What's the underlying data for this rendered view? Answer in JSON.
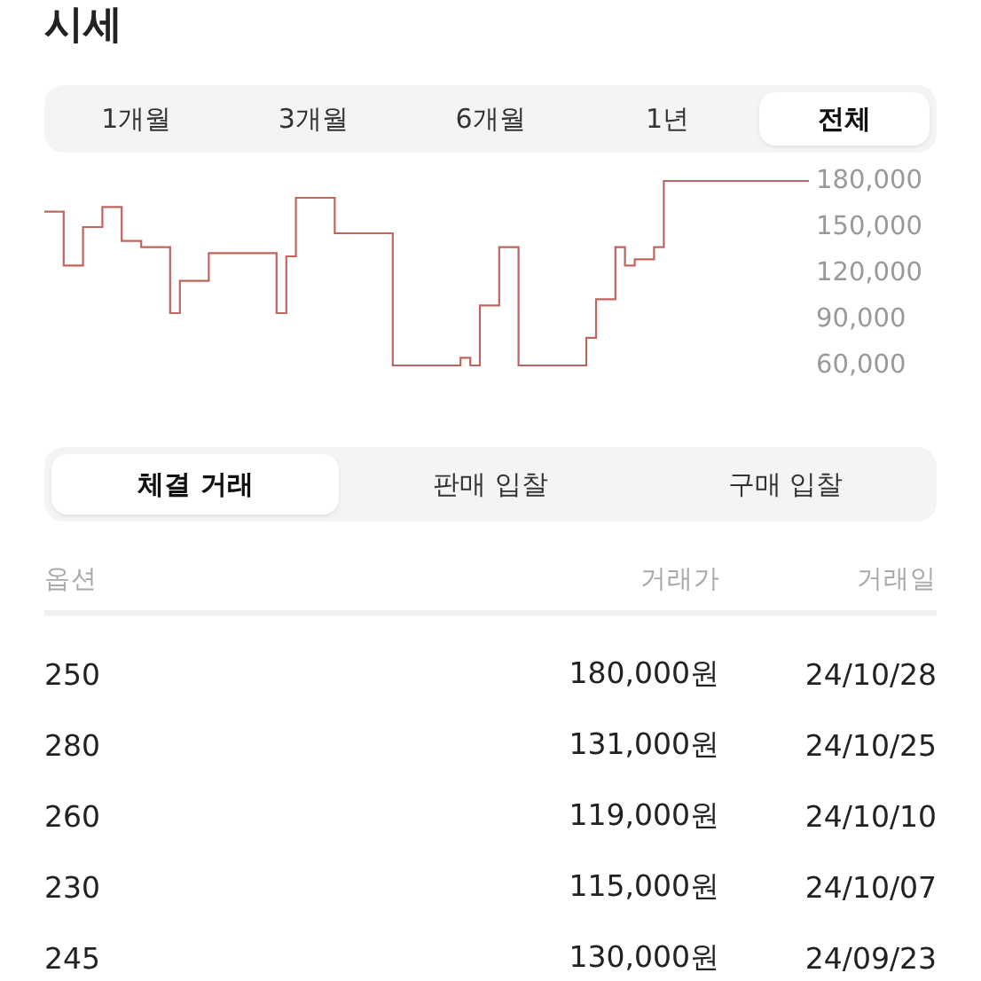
{
  "title": "시세",
  "period_tabs": [
    {
      "label": "1개월",
      "selected": false
    },
    {
      "label": "3개월",
      "selected": false
    },
    {
      "label": "6개월",
      "selected": false
    },
    {
      "label": "1년",
      "selected": false
    },
    {
      "label": "전체",
      "selected": true
    }
  ],
  "price_chart": {
    "chart_data": {
      "type": "line",
      "ylim": [
        60000,
        180000
      ],
      "yticks": [
        {
          "value": 180000,
          "label": "180,000"
        },
        {
          "value": 150000,
          "label": "150,000"
        },
        {
          "value": 120000,
          "label": "120,000"
        },
        {
          "value": 90000,
          "label": "90,000"
        },
        {
          "value": 60000,
          "label": "60,000"
        }
      ],
      "series": [
        {
          "color": "#c0655c",
          "values": [
            160000,
            160000,
            125000,
            125000,
            150000,
            150000,
            163000,
            163000,
            141000,
            141000,
            137000,
            137000,
            137000,
            94000,
            115000,
            115000,
            115000,
            133000,
            133000,
            133000,
            133000,
            133000,
            133000,
            133000,
            94000,
            131000,
            169000,
            169000,
            169000,
            169000,
            146000,
            146000,
            146000,
            146000,
            146000,
            146000,
            60000,
            60000,
            60000,
            60000,
            60000,
            60000,
            60000,
            65000,
            60000,
            99000,
            99000,
            137000,
            137000,
            60000,
            60000,
            60000,
            60000,
            60000,
            60000,
            60000,
            78000,
            103000,
            103000,
            137000,
            125000,
            129000,
            129000,
            137000,
            180000,
            180000,
            180000,
            180000,
            180000,
            180000,
            180000,
            180000,
            180000,
            180000,
            180000,
            180000,
            180000,
            180000,
            180000
          ]
        }
      ]
    }
  },
  "trade_tabs": [
    {
      "label": "체결 거래",
      "selected": true
    },
    {
      "label": "판매 입찰",
      "selected": false
    },
    {
      "label": "구매 입찰",
      "selected": false
    }
  ],
  "table": {
    "columns": [
      "옵션",
      "거래가",
      "거래일"
    ],
    "rows": [
      [
        "250",
        "180,000원",
        "24/10/28"
      ],
      [
        "280",
        "131,000원",
        "24/10/25"
      ],
      [
        "260",
        "119,000원",
        "24/10/10"
      ],
      [
        "230",
        "115,000원",
        "24/10/07"
      ],
      [
        "245",
        "130,000원",
        "24/09/23"
      ]
    ]
  }
}
